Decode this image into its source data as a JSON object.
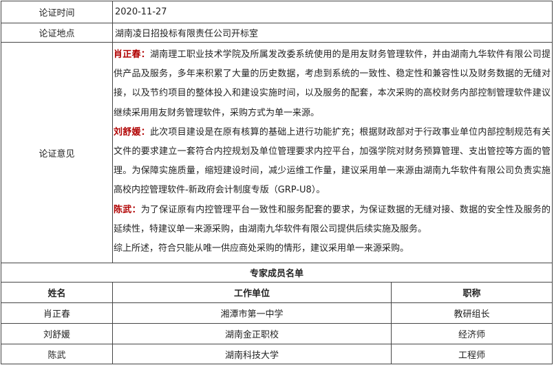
{
  "info": {
    "time_label": "论证时间",
    "time_value": "2020-11-27",
    "place_label": "论证地点",
    "place_value": "湖南凌日招投标有限责任公司开标室",
    "opinion_label": "论证意见"
  },
  "opinions": [
    {
      "speaker": "肖正春：",
      "text": "湖南理工职业技术学院及所属发改委系统使用的是用友财务管理软件，并由湖南九华软件有限公司提供产品及服务，多年来积累了大量的历史数据，考虑到系统的一致性、稳定性和兼容性以及财务数据的无缝对接，以及节约项目的整体投入和建设实施时间，以及服务的配套，本次采购的高校财务内部控制管理软件建议继续采用用友财务管理软件，采购方式为单一来源。"
    },
    {
      "speaker": "刘舒媛：",
      "text": "此次项目建设是在原有核算的基础上进行功能扩充；根据财政部对于行政事业单位内部控制规范有关文件的要求建立一套符合内控规划及单位管理要求内控平台，加强学院对财务预算管理、支出管控等方面的管理。为保障实施质量，缩短建设时间，减少运维工作量，建议采用单一来源由湖南九华软件有限公司负责实施高校内控管理软件-新政府会计制度专版（GRP-U8）。"
    },
    {
      "speaker": "陈武：",
      "text": "为了保证原有内控管理平台一致性和服务配套的要求，为保证数据的无缝对接、数据的安全性及服务的延续性，特建议单一来源采购，由湖南九华软件有限公司提供后续实施及服务。"
    }
  ],
  "conclusion": "综上所述，符合只能从唯一供应商处采购的情形，建议采用单一来源采购。",
  "experts": {
    "title": "专家成员名单",
    "headers": [
      "姓名",
      "工作单位",
      "职称"
    ],
    "rows": [
      [
        "肖正春",
        "湘潭市第一中学",
        "教研组长"
      ],
      [
        "刘舒媛",
        "湖南金正职校",
        "经济师"
      ],
      [
        "陈武",
        "湖南科技大学",
        "工程师"
      ]
    ]
  }
}
